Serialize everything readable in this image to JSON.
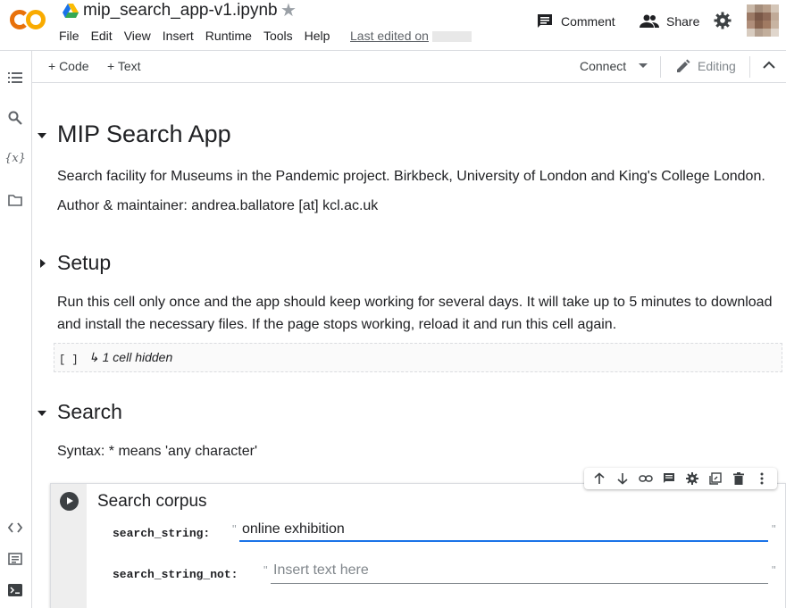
{
  "header": {
    "notebook_title": "mip_search_app-v1.ipynb",
    "last_edited": "Last edited on",
    "menu": [
      "File",
      "Edit",
      "View",
      "Insert",
      "Runtime",
      "Tools",
      "Help"
    ],
    "comment_label": "Comment",
    "share_label": "Share"
  },
  "toolbar": {
    "code_label": "+ Code",
    "text_label": "+ Text",
    "connect_label": "Connect",
    "editing_label": "Editing"
  },
  "notebook": {
    "title": "MIP Search App",
    "description": "Search facility for Museums in the Pandemic project. Birkbeck, University of London and King's College London.",
    "author": "Author & maintainer: andrea.ballatore [at] kcl.ac.uk",
    "setup_heading": "Setup",
    "setup_text": "Run this cell only once and the app should keep working for several days. It will take up to 5 minutes to download and install the necessary files. If the page stops working, reload it and run this cell again.",
    "hidden_bracket": "[ ]",
    "hidden_text": "↳ 1 cell hidden",
    "search_heading": "Search",
    "syntax_text": "Syntax: * means 'any character'"
  },
  "form": {
    "title": "Search corpus",
    "search_string_label": "search_string:",
    "search_string_value": "online exhibition",
    "search_string_not_label": "search_string_not:",
    "search_string_not_placeholder": "Insert text here"
  },
  "colors": {
    "accent": "#1a73e8",
    "logo_orange": "#f9ab00",
    "logo_dark_orange": "#e8710a"
  }
}
